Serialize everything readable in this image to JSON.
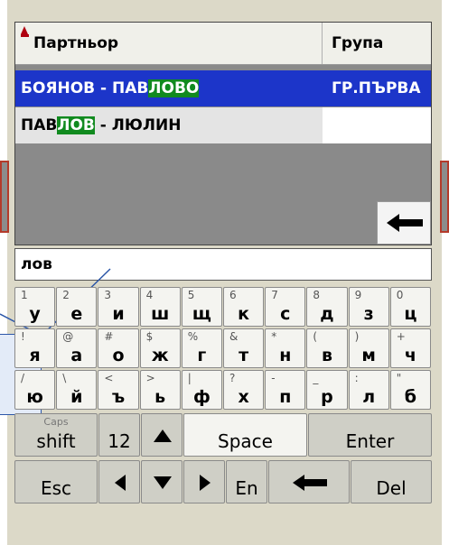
{
  "table": {
    "col_partner": "Партньор",
    "col_group": "Група",
    "rows": [
      {
        "pre": "БОЯНОВ - ПАВ",
        "hl": "ЛОВО",
        "post": "",
        "group": "ГР.ПЪРВА"
      },
      {
        "pre": "ПАВ",
        "hl": "ЛОВ",
        "post": " - ЛЮЛИН",
        "group": ""
      }
    ]
  },
  "search": {
    "value": "лов"
  },
  "keyboard": {
    "row1": [
      [
        "1",
        "у"
      ],
      [
        "2",
        "е"
      ],
      [
        "3",
        "и"
      ],
      [
        "4",
        "ш"
      ],
      [
        "5",
        "щ"
      ],
      [
        "6",
        "к"
      ],
      [
        "7",
        "с"
      ],
      [
        "8",
        "д"
      ],
      [
        "9",
        "з"
      ],
      [
        "0",
        "ц"
      ]
    ],
    "row2": [
      [
        "!",
        "я"
      ],
      [
        "@",
        "а"
      ],
      [
        "#",
        "о"
      ],
      [
        "$",
        "ж"
      ],
      [
        "%",
        "г"
      ],
      [
        "&",
        "т"
      ],
      [
        "*",
        "н"
      ],
      [
        "(",
        "в"
      ],
      [
        ")",
        "м"
      ],
      [
        "+",
        "ч"
      ]
    ],
    "row3": [
      [
        "/",
        "ю"
      ],
      [
        "\\",
        "й"
      ],
      [
        "<",
        "ъ"
      ],
      [
        ">",
        "ь"
      ],
      [
        "|",
        "ф"
      ],
      [
        "?",
        "х"
      ],
      [
        "-",
        "п"
      ],
      [
        "_",
        "р"
      ],
      [
        ":",
        "л"
      ],
      [
        "\"",
        "б"
      ]
    ],
    "caps": "Caps",
    "shift": "shift",
    "mode": "12",
    "space": "Space",
    "enter": "Enter",
    "esc": "Esc",
    "lang": "En",
    "del": "Del"
  },
  "colors": {
    "selected_row": "#1c35c9",
    "match_highlight": "#118a1f",
    "sort_marker": "#b00010"
  }
}
